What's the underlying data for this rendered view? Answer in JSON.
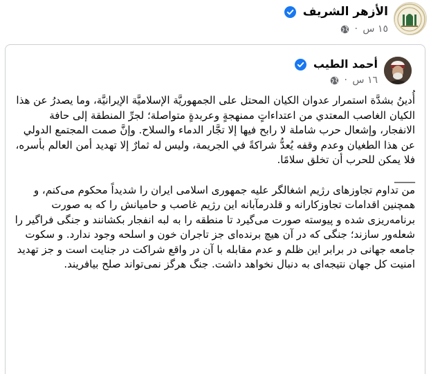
{
  "post": {
    "author": "الأزهر الشريف",
    "time": "١٥ س",
    "audience_icon": "globe-icon",
    "verified_color": "#1877f2"
  },
  "shared": {
    "author": "أحمد الطيب",
    "time": "١٦ س",
    "audience_icon": "globe-icon",
    "arabic_text": "أُدينُ بشدَّة استمرار عدوان الكيان المحتل على الجمهوريَّة الإسلاميَّة الإيرانيَّة، وما يصدرُ عن هذا الكيان الغاصب المعتدي من اعتداءاتٍ ممنهجةٍ وعربدةٍ متواصلة؛ لجرِّ المنطقة إلى حافة الانفجار، وإشعال حرب شاملة لا رابح فيها إلا تجَّار الدماء والسلاح. وإنَّ صمت المجتمع الدولي عن هذا الطغيان وعدم وقفه يُعدُّ شراكةً في الجريمة، وليس له ثمارٌ إلا تهديد أمن العالم بأسره، فلا يمكن للحرب أن تخلق سلامًا.",
    "separator": "____",
    "persian_text": "من تداوم تجاوزهای رژیم اشغالگر علیه جمهوری اسلامی ایران را شدیداً محکوم می‌کنم، و همچنین اقدامات تجاوزکارانه و قلدرمآبانه این رژیم غاصب و حامیانش را که به صورت برنامه‌ریزی شده و پیوسته صورت می‌گیرد تا منطقه را به لبه انفجار بکشانند و جنگی فراگیر را شعله‌ور سازند؛ جنگی که در آن هیچ برنده‌ای جز تاجران خون و اسلحه وجود ندارد. و سکوت جامعه جهانی در برابر این ظلم و عدم مقابله با آن در واقع شراکت در جنایت است و جز تهدید امنیت کل جهان نتیجه‌ای به دنبال نخواهد داشت. جنگ هرگز نمی‌تواند صلح بیافریند."
  }
}
